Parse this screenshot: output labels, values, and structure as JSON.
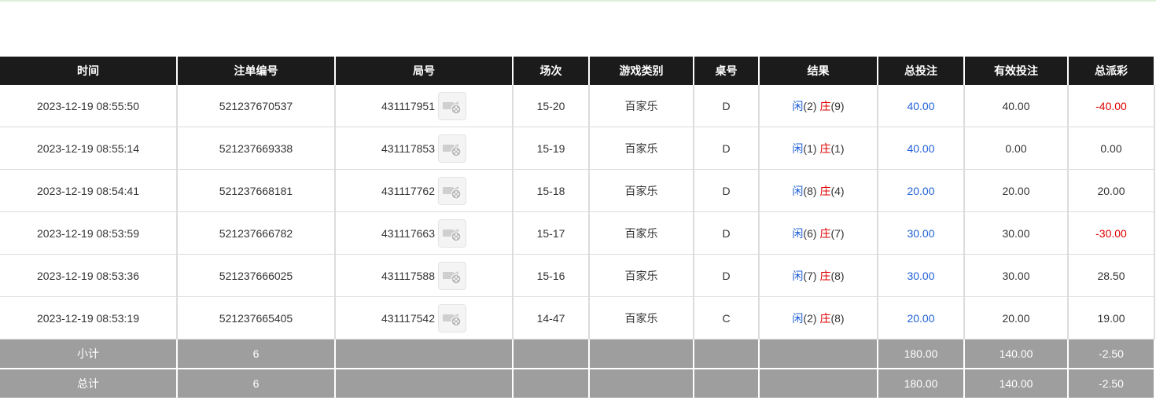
{
  "columns": [
    "时间",
    "注单编号",
    "局号",
    "场次",
    "游戏类别",
    "桌号",
    "结果",
    "总投注",
    "有效投注",
    "总派彩"
  ],
  "rows": [
    {
      "time": "2023-12-19 08:55:50",
      "order_id": "521237670537",
      "round": "431117951",
      "session": "15-20",
      "game": "百家乐",
      "table": "D",
      "player_label": "闲",
      "player_val": "(2)",
      "banker_label": "庄",
      "banker_val": "(9)",
      "total_bet": "40.00",
      "valid_bet": "40.00",
      "payout": "-40.00",
      "payout_color": "red"
    },
    {
      "time": "2023-12-19 08:55:14",
      "order_id": "521237669338",
      "round": "431117853",
      "session": "15-19",
      "game": "百家乐",
      "table": "D",
      "player_label": "闲",
      "player_val": "(1)",
      "banker_label": "庄",
      "banker_val": "(1)",
      "total_bet": "40.00",
      "valid_bet": "0.00",
      "payout": "0.00",
      "payout_color": "normal"
    },
    {
      "time": "2023-12-19 08:54:41",
      "order_id": "521237668181",
      "round": "431117762",
      "session": "15-18",
      "game": "百家乐",
      "table": "D",
      "player_label": "闲",
      "player_val": "(8)",
      "banker_label": "庄",
      "banker_val": "(4)",
      "total_bet": "20.00",
      "valid_bet": "20.00",
      "payout": "20.00",
      "payout_color": "normal"
    },
    {
      "time": "2023-12-19 08:53:59",
      "order_id": "521237666782",
      "round": "431117663",
      "session": "15-17",
      "game": "百家乐",
      "table": "D",
      "player_label": "闲",
      "player_val": "(6)",
      "banker_label": "庄",
      "banker_val": "(7)",
      "total_bet": "30.00",
      "valid_bet": "30.00",
      "payout": "-30.00",
      "payout_color": "red"
    },
    {
      "time": "2023-12-19 08:53:36",
      "order_id": "521237666025",
      "round": "431117588",
      "session": "15-16",
      "game": "百家乐",
      "table": "D",
      "player_label": "闲",
      "player_val": "(7)",
      "banker_label": "庄",
      "banker_val": "(8)",
      "total_bet": "30.00",
      "valid_bet": "30.00",
      "payout": "28.50",
      "payout_color": "normal"
    },
    {
      "time": "2023-12-19 08:53:19",
      "order_id": "521237665405",
      "round": "431117542",
      "session": "14-47",
      "game": "百家乐",
      "table": "C",
      "player_label": "闲",
      "player_val": "(2)",
      "banker_label": "庄",
      "banker_val": "(8)",
      "total_bet": "20.00",
      "valid_bet": "20.00",
      "payout": "19.00",
      "payout_color": "normal"
    }
  ],
  "subtotal": {
    "label": "小计",
    "count": "6",
    "total_bet": "180.00",
    "valid_bet": "140.00",
    "payout": "-2.50"
  },
  "total": {
    "label": "总计",
    "count": "6",
    "total_bet": "180.00",
    "valid_bet": "140.00",
    "payout": "-2.50"
  },
  "icons": {
    "video": "video-replay-icon"
  },
  "colors": {
    "header_bg": "#1b1b1b",
    "summary_bg": "#9e9e9e",
    "blue": "#1f5fd6",
    "red": "#e00000"
  }
}
